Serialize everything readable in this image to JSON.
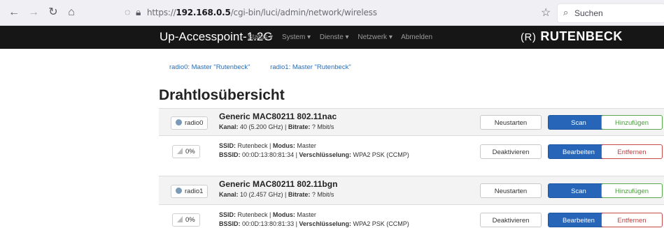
{
  "browser": {
    "url_prefix": "https://",
    "url_host": "192.168.0.5",
    "url_path": "/cgi-bin/luci/admin/network/wireless",
    "search_placeholder": "Suchen"
  },
  "header": {
    "brand": "Up-Accesspoint-1.2G",
    "menu": [
      "Status ▾",
      "System ▾",
      "Dienste ▾",
      "Netzwerk ▾",
      "Abmelden"
    ],
    "logo_mark": "(R)",
    "logo_text": "RUTENBECK"
  },
  "tabs": [
    "radio0: Master \"Rutenbeck\"",
    "radio1: Master \"Rutenbeck\""
  ],
  "page_title": "Drahtlosübersicht",
  "devices": [
    {
      "badge": "radio0",
      "title": "Generic MAC80211 802.11nac",
      "kanal_label": "Kanal:",
      "kanal": " 40 (5.200 GHz) | ",
      "bitrate_label": "Bitrate:",
      "bitrate": " ? Mbit/s",
      "buttons": {
        "restart": "Neustarten",
        "scan": "Scan",
        "add": "Hinzufügen"
      },
      "network": {
        "signal": "0%",
        "ssid_label": "SSID:",
        "ssid": " Rutenbeck | ",
        "mode_label": "Modus:",
        "mode": " Master",
        "bssid_label": "BSSID:",
        "bssid": " 00:0D:13:80:81:34 | ",
        "enc_label": "Verschlüsselung:",
        "enc": " WPA2 PSK (CCMP)",
        "buttons": {
          "disable": "Deaktivieren",
          "edit": "Bearbeiten",
          "remove": "Entfernen"
        }
      }
    },
    {
      "badge": "radio1",
      "title": "Generic MAC80211 802.11bgn",
      "kanal_label": "Kanal:",
      "kanal": " 10 (2.457 GHz) | ",
      "bitrate_label": "Bitrate:",
      "bitrate": " ? Mbit/s",
      "buttons": {
        "restart": "Neustarten",
        "scan": "Scan",
        "add": "Hinzufügen"
      },
      "network": {
        "signal": "0%",
        "ssid_label": "SSID:",
        "ssid": " Rutenbeck | ",
        "mode_label": "Modus:",
        "mode": " Master",
        "bssid_label": "BSSID:",
        "bssid": " 00:0D:13:80:81:33 | ",
        "enc_label": "Verschlüsselung:",
        "enc": " WPA2 PSK (CCMP)",
        "buttons": {
          "disable": "Deaktivieren",
          "edit": "Bearbeiten",
          "remove": "Entfernen"
        }
      }
    }
  ]
}
